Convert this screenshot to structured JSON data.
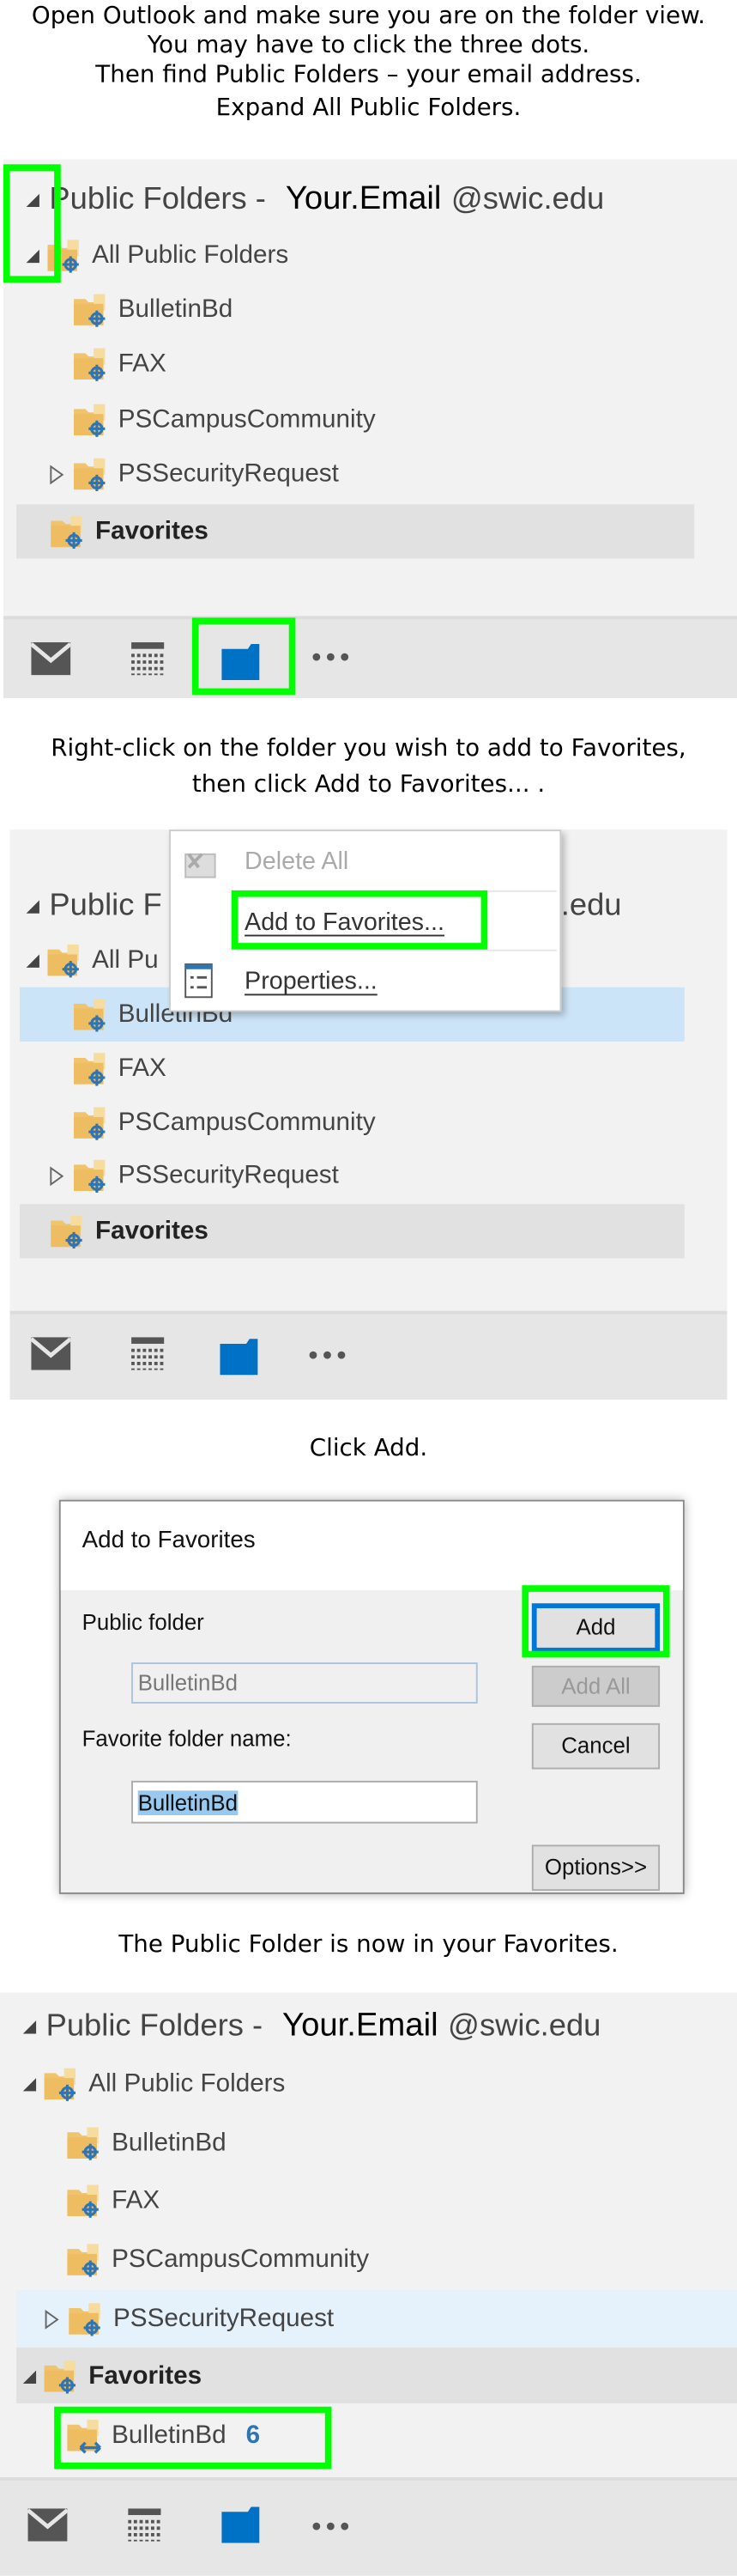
{
  "instructions": {
    "step1": [
      "Open Outlook and make sure you are on the folder view.",
      "You may have to click the three dots.",
      "Then find Public Folders – your email address.",
      "Expand All Public Folders."
    ],
    "step2": [
      "Right-click on the folder you wish to add to Favorites,",
      "then click Add to Favorites... ."
    ],
    "step3": "Click Add.",
    "step4": "The Public Folder is now in your Favorites."
  },
  "tree": {
    "title": "Public Folders -",
    "title_short": "Public F",
    "email": "Your.Email",
    "domain": "@swic.edu",
    "domain_partial": "ic.edu",
    "all_public_folders": "All Public Folders",
    "all_public_folders_partial": "All Pu",
    "folders": [
      "BulletinBd",
      "FAX",
      "PSCampusCommunity",
      "PSSecurityRequest"
    ],
    "favorites": "Favorites",
    "favorite_item": {
      "label": "BulletinBd",
      "unread_count": "6"
    }
  },
  "context_menu": {
    "items": [
      {
        "label": "Delete All",
        "icon": "delete-all-icon",
        "disabled": true
      },
      {
        "label": "Add to Favorites...",
        "icon": "",
        "disabled": false
      },
      {
        "label": "Properties...",
        "icon": "properties-icon",
        "disabled": false
      }
    ]
  },
  "dialog": {
    "title": "Add to Favorites",
    "public_folder_label": "Public folder",
    "public_folder_value": "BulletinBd",
    "favorite_name_label": "Favorite folder name:",
    "favorite_name_value": "BulletinBd",
    "buttons": {
      "add": "Add",
      "add_all": "Add All",
      "cancel": "Cancel",
      "options": "Options>>"
    }
  },
  "nav": {
    "items": [
      "mail-icon",
      "calendar-icon",
      "folder-icon",
      "more-icon"
    ]
  },
  "colors": {
    "highlight_box": "#00ff00",
    "accent": "#0072c6",
    "folder": "#f0c36d",
    "selected_row": "#cce4f7"
  }
}
